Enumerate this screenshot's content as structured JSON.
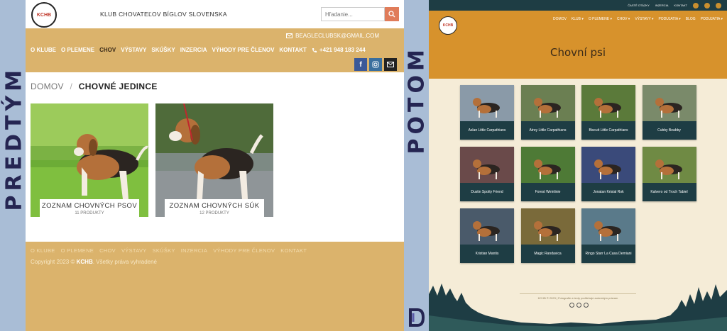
{
  "labels": {
    "before": "PREDTÝM",
    "after": "POTOM"
  },
  "before": {
    "logo_text": "KCHB",
    "club_name": "KLUB CHOVATEĽOV BÍGLOV SLOVENSKA",
    "search_placeholder": "Hľadanie...",
    "email": "BEAGLECLUBSK@GMAIL.COM",
    "menu": [
      "O KLUBE",
      "O PLEMENE",
      "CHOV",
      "VÝSTAVY",
      "SKÚŠKY",
      "INZERCIA",
      "VÝHODY PRE ČLENOV",
      "KONTAKT"
    ],
    "phone": "+421 948 183 244",
    "breadcrumb": {
      "home": "DOMOV",
      "sep": "/",
      "current": "CHOVNÉ JEDINCE"
    },
    "cards": [
      {
        "title": "ZOZNAM CHOVNÝCH PSOV",
        "count": "11 PRODUKTY"
      },
      {
        "title": "ZOZNAM CHOVNÝCH SÚK",
        "count": "12 PRODUKTY"
      }
    ],
    "footer_menu": [
      "O KLUBE",
      "O PLEMENE",
      "CHOV",
      "VÝSTAVY",
      "SKÚŠKY",
      "INZERCIA",
      "VÝHODY PRE ČLENOV",
      "KONTAKT"
    ],
    "copyright_pre": "Copyright 2023 ©",
    "copyright_brand": "KCHB",
    "copyright_post": ". Všetky práva vyhradené"
  },
  "after": {
    "topbar": [
      "ČASTÉ OTÁZKY",
      "INZERCIA",
      "KONTAKT"
    ],
    "logo_text": "KCHB",
    "menu": [
      "DOMOV",
      "KLUB ▾",
      "O PLEMENE ▾",
      "CHOV ▾",
      "VÝSTAVY ▾",
      "PODUJATIA ▾",
      "BLOG",
      "PODUJATIA ▾"
    ],
    "title": "Chovní psi",
    "dogs": [
      "Aslan Little Carpathians",
      "Atrey Little Carpathians",
      "Biscuit Little Carpathians",
      "Cubby Beabby",
      "Dustin Spotty Friend",
      "Forest Weinlinie",
      "Jonatan Kristal Rok",
      "Kalvero od Troch Tabiel",
      "Kristian Mantis",
      "Magic Randavica",
      "Ringo Starr La Casa Demiani"
    ],
    "footer_copy": "KCHB © 2023 | Fotografie a texty podliehajú autorským právam"
  },
  "colors": {
    "gold": "#dbb36c",
    "orange": "#d7922c",
    "teal": "#1e3d44"
  }
}
